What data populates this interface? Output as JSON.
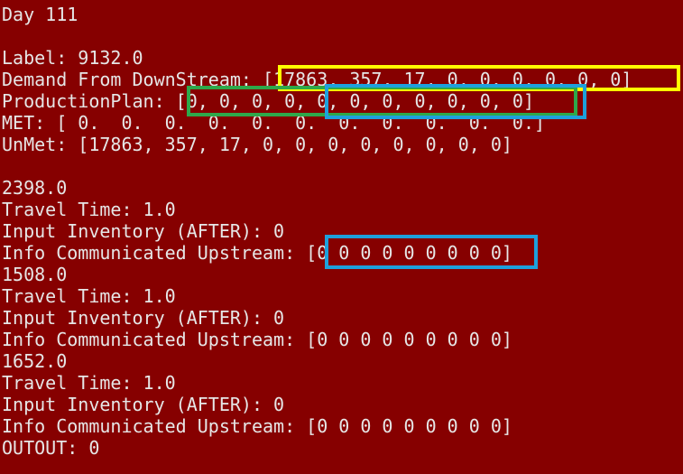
{
  "console": {
    "lines": {
      "day": "Day 111",
      "label": "Label: 9132.0",
      "demand": "Demand From DownStream: [17863, 357, 17, 0, 0, 0, 0, 0, 0]",
      "production_plan": "ProductionPlan: [0, 0, 0, 0, 0, 0, 0, 0, 0, 0, 0]",
      "met": "MET: [ 0.  0.  0.  0.  0.  0.  0.  0.  0.  0.  0.]",
      "unmet": "UnMet: [17863, 357, 17, 0, 0, 0, 0, 0, 0, 0, 0]",
      "stage1_value": "2398.0",
      "stage1_travel": "Travel Time: 1.0",
      "stage1_inventory": "Input Inventory (AFTER): 0",
      "stage1_info": "Info Communicated Upstream: [0 0 0 0 0 0 0 0 0]",
      "stage2_value": "1508.0",
      "stage2_travel": "Travel Time: 1.0",
      "stage2_inventory": "Input Inventory (AFTER): 0",
      "stage2_info": "Info Communicated Upstream: [0 0 0 0 0 0 0 0 0]",
      "stage3_value": "1652.0",
      "stage3_travel": "Travel Time: 1.0",
      "stage3_inventory": "Input Inventory (AFTER): 0",
      "stage3_info": "Info Communicated Upstream: [0 0 0 0 0 0 0 0 0]",
      "output": "OUTOUT: 0"
    }
  },
  "colors": {
    "background": "#860000",
    "text": "#e6e6e6",
    "highlight_yellow": "#ffff00",
    "highlight_green": "#2ea84a",
    "highlight_blue": "#1ea0dc"
  }
}
